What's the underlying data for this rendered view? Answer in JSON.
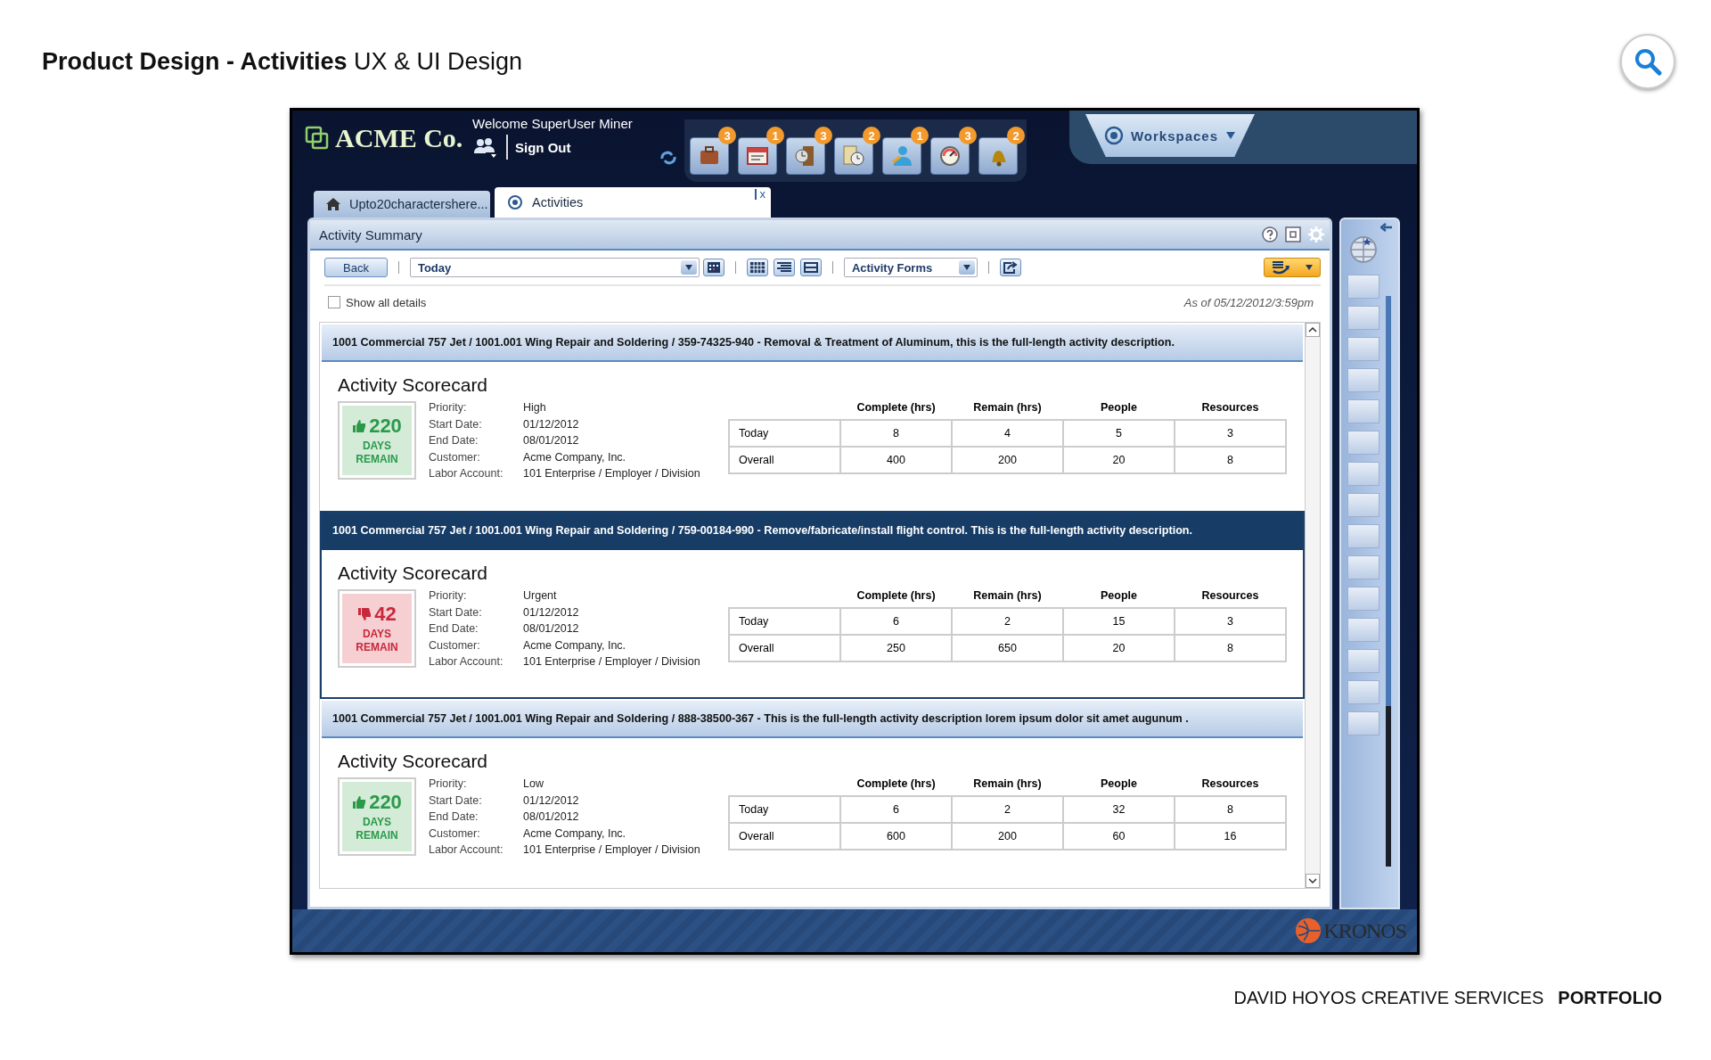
{
  "page_title": "**Product Design - Activities** UX & UI Design",
  "app": {
    "logo": "ACME Co.",
    "welcome": "Welcome SuperUser Miner",
    "sign_out": "Sign Out",
    "toolbar": [
      {
        "badge": "3"
      },
      {
        "badge": "1"
      },
      {
        "badge": "3"
      },
      {
        "badge": "2"
      },
      {
        "badge": "1"
      },
      {
        "badge": "3"
      },
      {
        "badge": "2"
      }
    ],
    "workspaces": "Workspaces",
    "tabs": [
      {
        "label": "Upto20charactershere...",
        "selected": false
      },
      {
        "label": "Activities",
        "selected": true,
        "close": "x"
      }
    ],
    "panel": {
      "title": "Activity Summary",
      "back": "Back",
      "date_range": "Today",
      "forms": "Activity Forms",
      "show_all": {
        "label": "Show all details",
        "checked": false
      },
      "as_of": "As of 05/12/2012/3:59pm",
      "activities": [
        {
          "description": "1001 Commercial 757 Jet / 1001.001 Wing Repair and Soldering / 359-74325-940 - Removal & Treatment of Aluminum, this is the full-length activity description.",
          "selected": false,
          "title": "Activity Scorecard",
          "kind": "on-track",
          "days": "220",
          "days_label": "DAYS REMAIN",
          "details": [
            {
              "label": "Priority:",
              "value": "High"
            },
            {
              "label": "Start Date:",
              "value": "01/12/2012"
            },
            {
              "label": "End Date:",
              "value": "08/01/2012"
            },
            {
              "label": "Customer:",
              "value": "Acme Company, Inc."
            },
            {
              "label": "Labor Account:",
              "value": "101 Enterprise / Employer / Division"
            }
          ],
          "table": {
            "columns": [
              "Complete (hrs)",
              "Remain (hrs)",
              "People",
              "Resources"
            ],
            "rows": [
              {
                "label": "Today",
                "cells": [
                  "8",
                  "4",
                  "5",
                  "3"
                ]
              },
              {
                "label": "Overall",
                "cells": [
                  "400",
                  "200",
                  "20",
                  "8"
                ]
              }
            ]
          }
        },
        {
          "description": "1001 Commercial 757 Jet / 1001.001 Wing Repair and Soldering / 759-00184-990 - Remove/fabricate/install flight control. This is the full-length activity description.",
          "selected": true,
          "title": "Activity Scorecard",
          "kind": "at-risk",
          "days": "42",
          "days_label": "DAYS REMAIN",
          "details": [
            {
              "label": "Priority:",
              "value": "Urgent"
            },
            {
              "label": "Start Date:",
              "value": "01/12/2012"
            },
            {
              "label": "End Date:",
              "value": "08/01/2012"
            },
            {
              "label": "Customer:",
              "value": "Acme Company, Inc."
            },
            {
              "label": "Labor Account:",
              "value": "101 Enterprise / Employer / Division"
            }
          ],
          "table": {
            "columns": [
              "Complete (hrs)",
              "Remain (hrs)",
              "People",
              "Resources"
            ],
            "rows": [
              {
                "label": "Today",
                "cells": [
                  "6",
                  "2",
                  "15",
                  "3"
                ]
              },
              {
                "label": "Overall",
                "cells": [
                  "250",
                  "650",
                  "20",
                  "8"
                ]
              }
            ]
          }
        },
        {
          "description": "1001 Commercial 757 Jet / 1001.001 Wing Repair and Soldering / 888-38500-367 - This is the full-length activity description lorem ipsum dolor sit amet augunum .",
          "selected": false,
          "title": "Activity Scorecard",
          "kind": "on-track",
          "days": "220",
          "days_label": "DAYS REMAIN",
          "details": [
            {
              "label": "Priority:",
              "value": "Low"
            },
            {
              "label": "Start Date:",
              "value": "01/12/2012"
            },
            {
              "label": "End Date:",
              "value": "08/01/2012"
            },
            {
              "label": "Customer:",
              "value": "Acme Company, Inc."
            },
            {
              "label": "Labor Account:",
              "value": "101 Enterprise / Employer / Division"
            }
          ],
          "table": {
            "columns": [
              "Complete (hrs)",
              "Remain (hrs)",
              "People",
              "Resources"
            ],
            "rows": [
              {
                "label": "Today",
                "cells": [
                  "6",
                  "2",
                  "32",
                  "8"
                ]
              },
              {
                "label": "Overall",
                "cells": [
                  "600",
                  "200",
                  "60",
                  "16"
                ]
              }
            ]
          }
        }
      ]
    },
    "footer_logo": "KRONOS"
  },
  "credit": {
    "studio": "DAVID HOYOS CREATIVE SERVICES",
    "section": "PORTFOLIO"
  }
}
